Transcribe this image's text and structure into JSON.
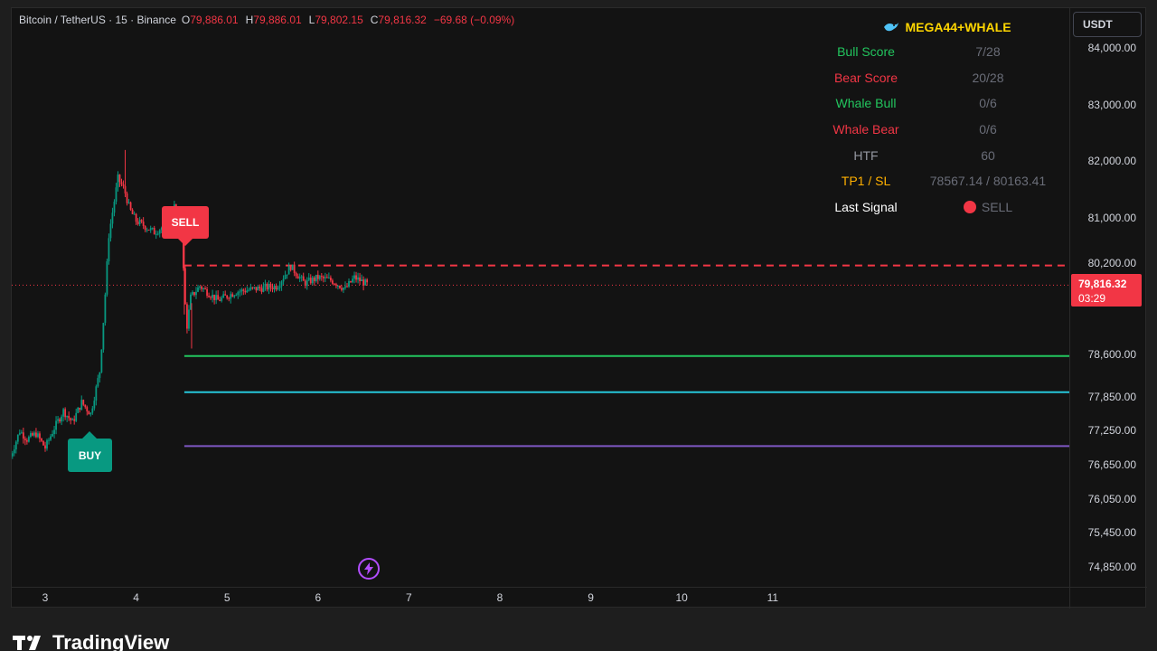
{
  "legend": {
    "symbol": "Bitcoin / TetherUS · 15 · Binance",
    "open_label": "O",
    "open": "79,886.01",
    "high_label": "H",
    "high": "79,886.01",
    "low_label": "L",
    "low": "79,802.15",
    "close_label": "C",
    "close": "79,816.32",
    "change": "−69.68 (−0.09%)"
  },
  "currency": "USDT",
  "current_price": {
    "value": "79,816.32",
    "countdown": "03:29"
  },
  "info_table": {
    "title": "MEGA44+WHALE",
    "rows": [
      {
        "label": "Bull Score",
        "value": "7/28",
        "color": "#22c55e"
      },
      {
        "label": "Bear Score",
        "value": "20/28",
        "color": "#f23645"
      },
      {
        "label": "Whale Bull",
        "value": "0/6",
        "color": "#22c55e"
      },
      {
        "label": "Whale Bear",
        "value": "0/6",
        "color": "#f23645"
      },
      {
        "label": "HTF",
        "value": "60",
        "color": "#9598a1"
      },
      {
        "label": "TP1 / SL",
        "value": "78567.14 / 80163.41",
        "color": "#ffb000"
      },
      {
        "label": "Last Signal",
        "value": "SELL",
        "color": "#ffffff"
      }
    ]
  },
  "price_axis": [
    "84,000.00",
    "83,000.00",
    "82,000.00",
    "81,000.00",
    "80,200.00",
    "78,600.00",
    "77,850.00",
    "77,250.00",
    "76,650.00",
    "76,050.00",
    "75,450.00",
    "74,850.00"
  ],
  "time_axis": [
    "3",
    "4",
    "5",
    "6",
    "7",
    "8",
    "9",
    "10",
    "11"
  ],
  "signals": {
    "sell": "SELL",
    "buy": "BUY"
  },
  "brand": "TradingView",
  "colors": {
    "up": "#089981",
    "down": "#f23645",
    "sl_line": "#f23645",
    "tp1_line": "#22c55e",
    "tp2_line": "#26c6da",
    "tp3_line": "#7e57c2"
  },
  "icons": {
    "title": "whale-icon",
    "bolt": "lightning-icon"
  },
  "chart_data": {
    "type": "candlestick",
    "title": "",
    "xlabel": "",
    "ylabel": "",
    "ylim": [
      74500,
      84700
    ],
    "x_ticks": [
      "3",
      "4",
      "5",
      "6",
      "7",
      "8",
      "9",
      "10",
      "11"
    ],
    "path_points": [
      [
        2.62,
        76800
      ],
      [
        2.72,
        77250
      ],
      [
        2.8,
        77100
      ],
      [
        2.9,
        77200
      ],
      [
        3.0,
        76950
      ],
      [
        3.1,
        77300
      ],
      [
        3.2,
        77600
      ],
      [
        3.3,
        77400
      ],
      [
        3.4,
        77750
      ],
      [
        3.5,
        77550
      ],
      [
        3.6,
        78300
      ],
      [
        3.65,
        79400
      ],
      [
        3.7,
        80700
      ],
      [
        3.75,
        81200
      ],
      [
        3.8,
        81700
      ],
      [
        3.87,
        81500
      ],
      [
        3.93,
        81150
      ],
      [
        4.0,
        80950
      ],
      [
        4.1,
        80850
      ],
      [
        4.2,
        80750
      ],
      [
        4.3,
        80850
      ],
      [
        4.42,
        81200
      ],
      [
        4.5,
        80950
      ],
      [
        4.53,
        79650
      ],
      [
        4.56,
        79100
      ],
      [
        4.6,
        79600
      ],
      [
        4.7,
        79800
      ],
      [
        4.9,
        79550
      ],
      [
        5.1,
        79700
      ],
      [
        5.3,
        79750
      ],
      [
        5.55,
        79800
      ],
      [
        5.7,
        80150
      ],
      [
        5.85,
        79850
      ],
      [
        6.0,
        79950
      ],
      [
        6.15,
        79900
      ],
      [
        6.3,
        79750
      ],
      [
        6.4,
        79950
      ],
      [
        6.5,
        79870
      ],
      [
        6.55,
        79816
      ]
    ],
    "last_close": 79816.32,
    "levels": [
      {
        "name": "SL",
        "value": 80163.41,
        "style": "dashed",
        "start_x": 4.53
      },
      {
        "name": "TP1",
        "value": 78567.14,
        "style": "solid",
        "start_x": 4.53
      },
      {
        "name": "TP2",
        "value": 77930,
        "style": "solid",
        "start_x": 4.53
      },
      {
        "name": "TP3",
        "value": 76980,
        "style": "solid",
        "start_x": 4.53
      }
    ],
    "signals": [
      {
        "type": "SELL",
        "x": 4.53,
        "price": 81050
      },
      {
        "type": "BUY",
        "x": 3.48,
        "price": 77350
      }
    ]
  }
}
